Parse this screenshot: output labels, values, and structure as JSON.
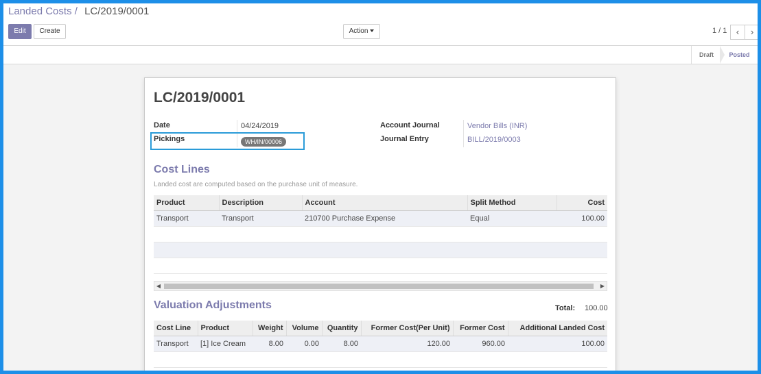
{
  "breadcrumb": {
    "parent": "Landed Costs",
    "separator": "/",
    "current": "LC/2019/0001"
  },
  "buttons": {
    "edit": "Edit",
    "create": "Create",
    "action": "Action"
  },
  "pager": {
    "value": "1 / 1",
    "prev": "‹",
    "next": "›"
  },
  "status": {
    "stages": [
      "Draft",
      "Posted"
    ],
    "active": "Posted"
  },
  "record": {
    "name": "LC/2019/0001",
    "date_label": "Date",
    "date": "04/24/2019",
    "pickings_label": "Pickings",
    "picking_tag": "WH/IN/00006",
    "journal_label": "Account Journal",
    "journal": "Vendor Bills (INR)",
    "entry_label": "Journal Entry",
    "entry": "BILL/2019/0003"
  },
  "cost_lines": {
    "title": "Cost Lines",
    "note": "Landed cost are computed based on the purchase unit of measure.",
    "columns": [
      "Product",
      "Description",
      "Account",
      "Split Method",
      "Cost"
    ],
    "rows": [
      [
        "Transport",
        "Transport",
        "210700 Purchase Expense",
        "Equal",
        "100.00"
      ]
    ]
  },
  "valuation": {
    "title": "Valuation Adjustments",
    "total_label": "Total:",
    "total": "100.00",
    "columns": [
      "Cost Line",
      "Product",
      "Weight",
      "Volume",
      "Quantity",
      "Former Cost(Per Unit)",
      "Former Cost",
      "Additional Landed Cost"
    ],
    "rows": [
      [
        "Transport",
        "[1] Ice Cream",
        "8.00",
        "0.00",
        "8.00",
        "120.00",
        "960.00",
        "100.00"
      ]
    ]
  },
  "colors": {
    "brand": "#7c7bad",
    "highlight": "#2a9bd8",
    "frame": "#1d8fe8"
  }
}
